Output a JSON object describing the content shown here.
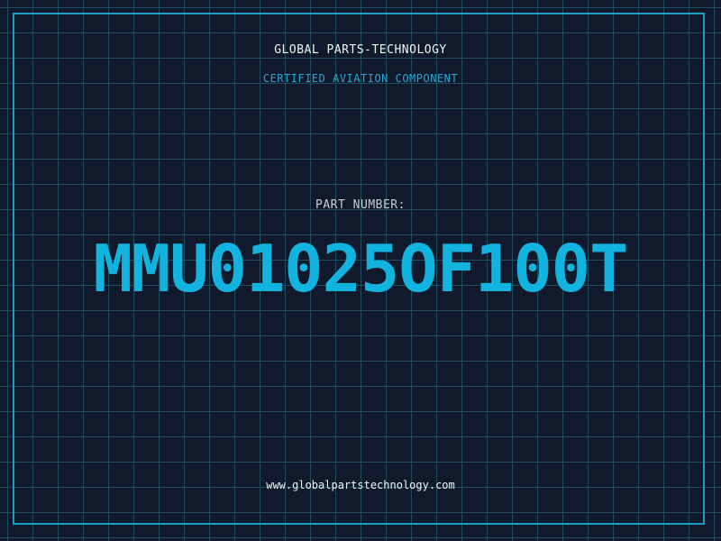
{
  "header": {
    "company": "GLOBAL PARTS-TECHNOLOGY",
    "tagline": "CERTIFIED AVIATION COMPONENT"
  },
  "part": {
    "label": "PART NUMBER:",
    "number": "MMU01025OF100T"
  },
  "footer": {
    "website": "www.globalpartstechnology.com"
  },
  "colors": {
    "background": "#111a2c",
    "grid": "#1d4e5e",
    "accent": "#12b3de",
    "text": "#f1f4f7"
  }
}
